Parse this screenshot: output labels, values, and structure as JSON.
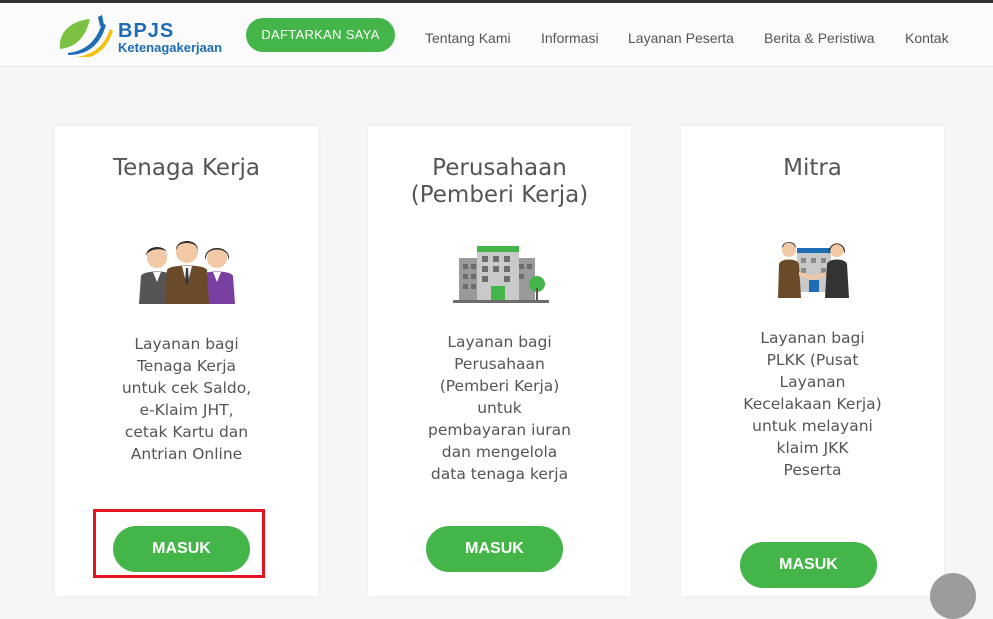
{
  "header": {
    "logo_line1": "BPJS",
    "logo_line2": "Ketenagakerjaan",
    "cta_label": "DAFTARKAN SAYA",
    "nav": [
      "Tentang Kami",
      "Informasi",
      "Layanan Peserta",
      "Berita & Peristiwa",
      "Kontak"
    ]
  },
  "cards": [
    {
      "title_lines": [
        "Tenaga Kerja"
      ],
      "icon": "workers-group-icon",
      "desc_lines": [
        "Layanan bagi",
        "Tenaga Kerja",
        "untuk cek Saldo,",
        "e-Klaim JHT,",
        "cetak Kartu dan",
        "Antrian Online"
      ],
      "button": "MASUK"
    },
    {
      "title_lines": [
        "Perusahaan",
        "(Pemberi Kerja)"
      ],
      "icon": "office-building-icon",
      "desc_lines": [
        "Layanan bagi",
        "Perusahaan",
        "(Pemberi Kerja)",
        "untuk",
        "pembayaran iuran",
        "dan mengelola",
        "data tenaga kerja"
      ],
      "button": "MASUK"
    },
    {
      "title_lines": [
        "Mitra"
      ],
      "icon": "partners-handshake-icon",
      "desc_lines": [
        "Layanan bagi",
        "PLKK (Pusat",
        "Layanan",
        "Kecelakaan Kerja)",
        "untuk melayani",
        "klaim JKK",
        "Peserta"
      ],
      "button": "MASUK"
    }
  ],
  "colors": {
    "brand_green": "#43b549",
    "brand_blue": "#1c6db5",
    "highlight_red": "#e3161f"
  }
}
